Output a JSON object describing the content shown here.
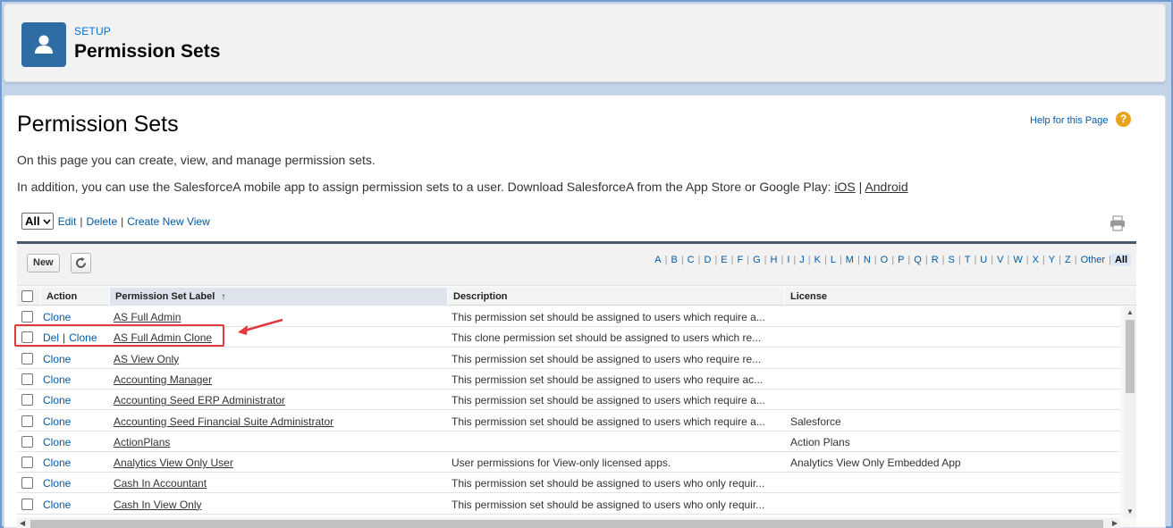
{
  "header": {
    "eyebrow": "SETUP",
    "title": "Permission Sets",
    "icon": "user-icon",
    "accent": "#2e6da4"
  },
  "page": {
    "title": "Permission Sets",
    "help_link": "Help for this Page",
    "intro_line1": "On this page you can create, view, and manage permission sets.",
    "intro_line2_prefix": "In addition, you can use the SalesforceA mobile app to assign permission sets to a user. Download SalesforceA from the App Store or Google Play: ",
    "ios_link": "iOS",
    "intro_sep": " | ",
    "android_link": "Android"
  },
  "view_bar": {
    "selected_view": "All",
    "edit": "Edit",
    "delete": "Delete",
    "create_new_view": "Create New View",
    "sep": "|"
  },
  "toolbar": {
    "new_label": "New",
    "alphabet": [
      "A",
      "B",
      "C",
      "D",
      "E",
      "F",
      "G",
      "H",
      "I",
      "J",
      "K",
      "L",
      "M",
      "N",
      "O",
      "P",
      "Q",
      "R",
      "S",
      "T",
      "U",
      "V",
      "W",
      "X",
      "Y",
      "Z",
      "Other",
      "All"
    ],
    "active_letter": "All"
  },
  "columns": {
    "action": "Action",
    "label": "Permission Set Label",
    "sort_indicator": "↑",
    "description": "Description",
    "license": "License"
  },
  "rows": [
    {
      "actions": [
        "Clone"
      ],
      "label": "AS Full Admin",
      "description": "This permission set should be assigned to users which require a...",
      "license": ""
    },
    {
      "actions": [
        "Del",
        "Clone"
      ],
      "label": "AS Full Admin Clone",
      "description": "This clone permission set should be assigned to users which re...",
      "license": ""
    },
    {
      "actions": [
        "Clone"
      ],
      "label": "AS View Only",
      "description": "This permission set should be assigned to users who require re...",
      "license": ""
    },
    {
      "actions": [
        "Clone"
      ],
      "label": "Accounting Manager",
      "description": "This permission set should be assigned to users who require ac...",
      "license": ""
    },
    {
      "actions": [
        "Clone"
      ],
      "label": "Accounting Seed ERP Administrator",
      "description": "This permission set should be assigned to users which require a...",
      "license": ""
    },
    {
      "actions": [
        "Clone"
      ],
      "label": "Accounting Seed Financial Suite Administrator",
      "description": "This permission set should be assigned to users which require a...",
      "license": "Salesforce"
    },
    {
      "actions": [
        "Clone"
      ],
      "label": "ActionPlans",
      "description": "",
      "license": "Action Plans"
    },
    {
      "actions": [
        "Clone"
      ],
      "label": "Analytics View Only User",
      "description": "User permissions for View-only licensed apps.",
      "license": "Analytics View Only Embedded App"
    },
    {
      "actions": [
        "Clone"
      ],
      "label": "Cash In Accountant",
      "description": "This permission set should be assigned to users who only requir...",
      "license": ""
    },
    {
      "actions": [
        "Clone"
      ],
      "label": "Cash In View Only",
      "description": "This permission set should be assigned to users who only requir...",
      "license": ""
    }
  ],
  "colors": {
    "link": "#015ba7",
    "annotation": "#e0393e",
    "help_icon": "#e8a21b"
  }
}
